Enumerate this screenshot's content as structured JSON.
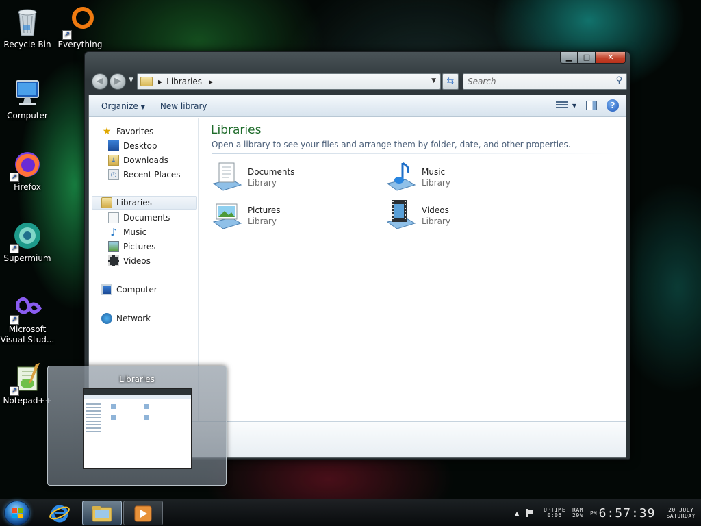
{
  "desktop": {
    "icons": [
      {
        "label": "Recycle Bin"
      },
      {
        "label": "Everything"
      },
      {
        "label": "Computer"
      },
      {
        "label": "Firefox"
      },
      {
        "label": "Supermium"
      },
      {
        "label": "Microsoft Visual Stud..."
      },
      {
        "label": "Notepad++"
      }
    ]
  },
  "window": {
    "caption_buttons": {
      "minimize": "▁",
      "maximize": "□",
      "close": "✕"
    },
    "address": {
      "path": [
        "Libraries"
      ]
    },
    "search": {
      "placeholder": "Search"
    },
    "toolbar": {
      "organize": "Organize",
      "new_library": "New library"
    },
    "nav": {
      "favorites": "Favorites",
      "desktop": "Desktop",
      "downloads": "Downloads",
      "recent": "Recent Places",
      "libraries": "Libraries",
      "documents": "Documents",
      "music": "Music",
      "pictures": "Pictures",
      "videos": "Videos",
      "computer": "Computer",
      "network": "Network"
    },
    "main": {
      "title": "Libraries",
      "subtitle": "Open a library to see your files and arrange them by folder, date, and other properties.",
      "items": [
        {
          "name": "Documents",
          "kind": "Library"
        },
        {
          "name": "Music",
          "kind": "Library"
        },
        {
          "name": "Pictures",
          "kind": "Library"
        },
        {
          "name": "Videos",
          "kind": "Library"
        }
      ]
    }
  },
  "thumbnail": {
    "title": "Libraries"
  },
  "taskbar": {
    "tray": {
      "uptime_label": "UPTIME",
      "uptime_value": "0:06",
      "ram_label": "RAM",
      "ram_value": "29%",
      "ampm": "PM",
      "time": "6:57:39",
      "date": "20 JULY",
      "day": "SATURDAY"
    }
  },
  "colors": {
    "library_title": "#1e6b2a",
    "close_button": "#c2432b",
    "accent_blue": "#2a7bc8"
  }
}
